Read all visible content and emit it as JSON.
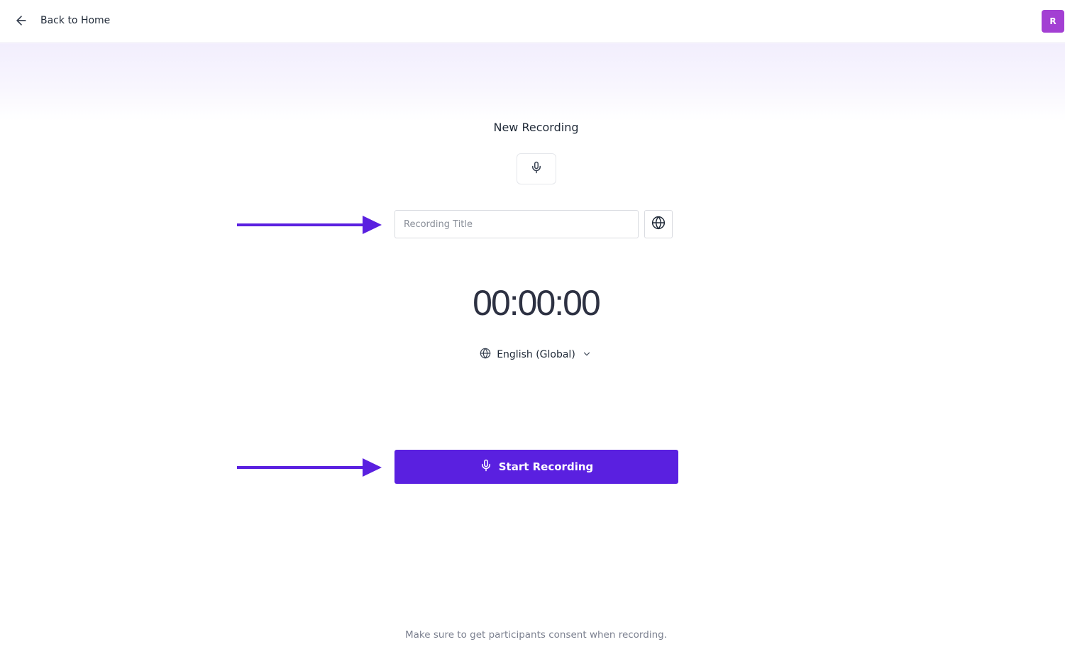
{
  "header": {
    "back_label": "Back to Home",
    "back_icon": "arrow-left-icon",
    "avatar_initial": "R",
    "avatar_color": "#a33fd3"
  },
  "main": {
    "title": "New Recording",
    "mic_icon": "microphone-icon",
    "title_input": {
      "value": "",
      "placeholder": "Recording Title"
    },
    "globe_icon": "globe-icon",
    "timer": "00:00:00",
    "language": {
      "selected": "English (Global)",
      "icon": "globe-icon",
      "chevron_icon": "chevron-down-icon"
    },
    "start_button": {
      "label": "Start Recording",
      "icon": "microphone-icon",
      "color": "#5a20e0"
    }
  },
  "annotations": {
    "arrow_color": "#5a20e0"
  },
  "footer": {
    "consent_text": "Make sure to get participants consent when recording."
  }
}
